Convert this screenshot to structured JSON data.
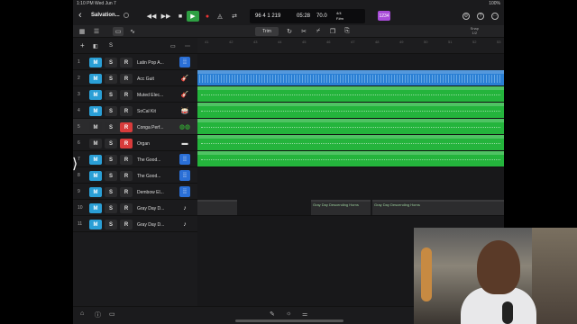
{
  "statusbar": {
    "time": "1:10 PM  Wed Jun 7",
    "battery": "100%"
  },
  "controlbar": {
    "project_title": "Salvation...",
    "lcd": {
      "position": "96 4 1 219",
      "time": "05:28",
      "tempo": "70.0",
      "sig_top": "4/4",
      "sig_bottom": "F#m"
    },
    "key_badge": "1234"
  },
  "toolbar": {
    "trim_label": "Trim",
    "snap_label": "Snap",
    "snap_value": "1/2"
  },
  "header": {
    "add": "+",
    "solo": "S"
  },
  "ruler": [
    "41",
    "42",
    "43",
    "44",
    "45",
    "46",
    "47",
    "48",
    "49",
    "50",
    "51",
    "52",
    "53"
  ],
  "tracks": [
    {
      "num": "1",
      "name": "Latin Pop A...",
      "m": true,
      "r": false,
      "icon": "audio-icon",
      "iconstyle": "blue"
    },
    {
      "num": "2",
      "name": "Acc Guit",
      "m": true,
      "r": false,
      "icon": "acoustic-guitar-icon",
      "iconstyle": "guitar"
    },
    {
      "num": "3",
      "name": "Muted Elec...",
      "m": true,
      "r": false,
      "icon": "electric-guitar-icon",
      "iconstyle": "guitar"
    },
    {
      "num": "4",
      "name": "SoCal Kit",
      "m": true,
      "r": false,
      "icon": "drum-kit-icon",
      "iconstyle": "drum"
    },
    {
      "num": "5",
      "name": "Conga Perf...",
      "m": false,
      "r": true,
      "icon": "conga-icon",
      "iconstyle": "green"
    },
    {
      "num": "6",
      "name": "Organ",
      "m": false,
      "r": true,
      "icon": "organ-icon",
      "iconstyle": "organ"
    },
    {
      "num": "7",
      "name": "The Good...",
      "m": true,
      "r": false,
      "icon": "audio-icon",
      "iconstyle": "blue"
    },
    {
      "num": "8",
      "name": "The Good...",
      "m": true,
      "r": false,
      "icon": "audio-icon",
      "iconstyle": "blue"
    },
    {
      "num": "9",
      "name": "Dembow El...",
      "m": true,
      "r": false,
      "icon": "audio-icon",
      "iconstyle": "blue"
    },
    {
      "num": "10",
      "name": "Gray Day D...",
      "m": true,
      "r": false,
      "icon": "horn-icon",
      "iconstyle": "horn"
    },
    {
      "num": "11",
      "name": "Gray Day D...",
      "m": true,
      "r": false,
      "icon": "horn-icon",
      "iconstyle": "horn"
    }
  ],
  "regions": {
    "horns_label_1": "Gray Day Descending Horns",
    "horns_label_2": "Gray Day Descending Horns"
  },
  "colors": {
    "accent_blue": "#2a9fd6",
    "record_red": "#d93b3b",
    "region_green": "#24b43c",
    "region_blue": "#2a7fd4",
    "key_purple": "#a84cd8"
  }
}
